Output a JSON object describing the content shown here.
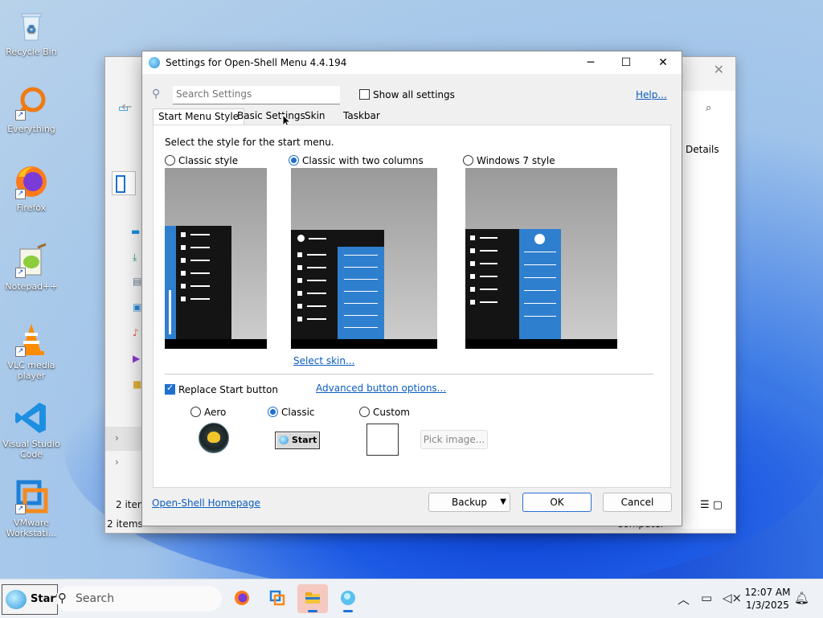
{
  "desktop": {
    "icons": [
      {
        "label": "Recycle Bin"
      },
      {
        "label": "Everything"
      },
      {
        "label": "Firefox"
      },
      {
        "label": "Notepad++"
      },
      {
        "label": "VLC media player"
      },
      {
        "label": "Visual Studio Code"
      },
      {
        "label": "VMware Workstati..."
      }
    ]
  },
  "explorer": {
    "details_label": "Details",
    "status_items_1": "2 item",
    "status_items_2": "2 items",
    "computer_label": "Computer"
  },
  "dialog": {
    "title": "Settings for Open-Shell Menu 4.4.194",
    "search_placeholder": "Search Settings",
    "show_all_label": "Show all settings",
    "help_link": "Help...",
    "tabs": [
      {
        "label": "Start Menu Style",
        "active": true
      },
      {
        "label": "Basic Settings",
        "active": false
      },
      {
        "label": "Skin",
        "active": false
      },
      {
        "label": "Taskbar",
        "active": false
      }
    ],
    "prompt": "Select the style for the start menu.",
    "styles": [
      {
        "label": "Classic style",
        "selected": false
      },
      {
        "label": "Classic with two columns",
        "selected": true
      },
      {
        "label": "Windows 7 style",
        "selected": false
      }
    ],
    "select_skin_link": "Select skin...",
    "replace_start_label": "Replace Start button",
    "replace_start_checked": true,
    "advanced_link": "Advanced button options...",
    "button_styles": [
      {
        "label": "Aero",
        "selected": false
      },
      {
        "label": "Classic",
        "selected": true
      },
      {
        "label": "Custom",
        "selected": false
      }
    ],
    "classic_preview_label": "Start",
    "pick_image_label": "Pick image...",
    "homepage_link": "Open-Shell Homepage",
    "backup_label": "Backup",
    "ok_label": "OK",
    "cancel_label": "Cancel"
  },
  "taskbar": {
    "start_label": "Start",
    "search_placeholder": "Search",
    "time": "12:07 AM",
    "date": "1/3/2025"
  },
  "colors": {
    "accent": "#1e6fd0",
    "menu_blue": "#2f7fcf",
    "menu_dark": "#141414",
    "preview_gray": "#b5b5b5"
  }
}
